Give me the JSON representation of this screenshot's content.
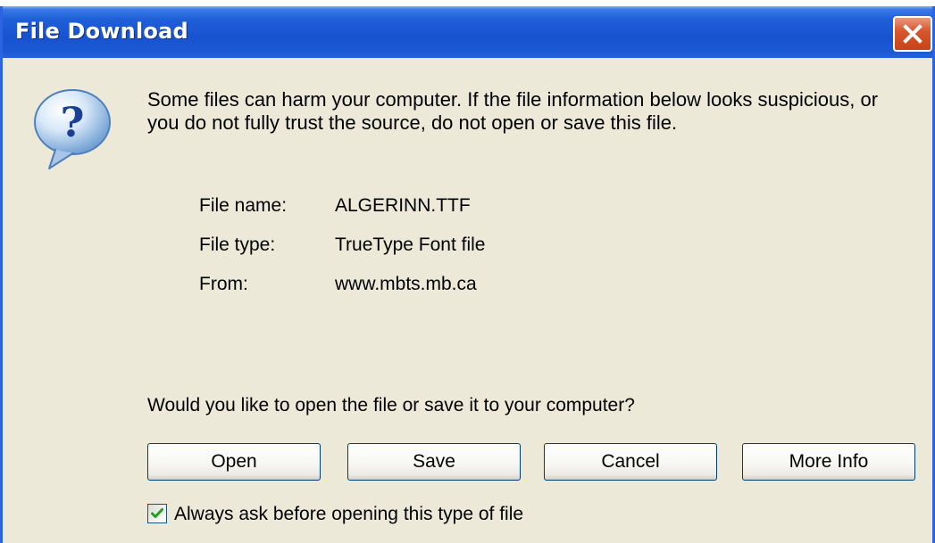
{
  "window": {
    "title": "File Download"
  },
  "titlebar": {
    "close_icon": "close-x-icon"
  },
  "dialog": {
    "icon": "question-icon",
    "message": "Some files can harm your computer. If the file information below looks suspicious, or you do not fully trust the source, do not open or save this file.",
    "file_info": [
      {
        "label": "File name:",
        "value": "ALGERINN.TTF"
      },
      {
        "label": "File type:",
        "value": "TrueType Font file"
      },
      {
        "label": "From:",
        "value": "www.mbts.mb.ca"
      }
    ],
    "question": "Would you like to open the file or save it to your computer?",
    "buttons": {
      "open": "Open",
      "save": "Save",
      "cancel": "Cancel",
      "more_info": "More Info"
    },
    "always_ask": {
      "label": "Always ask before opening this type of file",
      "checked": true
    }
  },
  "colors": {
    "titlebar": "#1853cf",
    "close_button": "#d8572f",
    "dialog_background": "#ece9d8",
    "button_border": "#003c74",
    "check_mark": "#21a121"
  }
}
